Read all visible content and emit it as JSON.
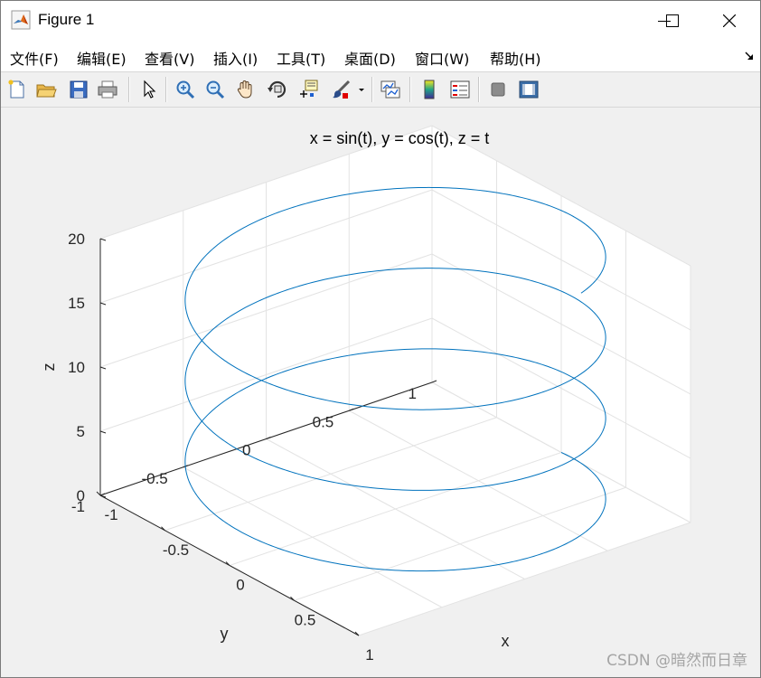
{
  "window": {
    "title": "Figure 1",
    "icon": "matlab-logo-icon",
    "controls": [
      "minimize-icon",
      "maximize-icon",
      "close-icon"
    ]
  },
  "menu": {
    "items": [
      "文件(F)",
      "编辑(E)",
      "查看(V)",
      "插入(I)",
      "工具(T)",
      "桌面(D)",
      "窗口(W)",
      "帮助(H)"
    ]
  },
  "toolbar": {
    "icons": [
      "new-figure-icon",
      "open-file-icon",
      "save-icon",
      "print-icon",
      "pointer-icon",
      "zoom-in-icon",
      "zoom-out-icon",
      "pan-hand-icon",
      "rotate-3d-icon",
      "data-cursor-icon",
      "brush-icon",
      "link-plot-icon",
      "colorbar-icon",
      "legend-icon",
      "hide-plot-tools-icon",
      "show-plot-tools-icon"
    ]
  },
  "chart_data": {
    "type": "line",
    "projection": "3d",
    "title": "x = sin(t), y = cos(t), z = t",
    "xlabel": "x",
    "ylabel": "y",
    "zlabel": "z",
    "series": [
      {
        "equation": "x = sin(t), y = cos(t), z = t",
        "t_range": [
          0,
          20
        ],
        "color": "#0072bd"
      }
    ],
    "xlim": [
      -1,
      1
    ],
    "ylim": [
      -1,
      1
    ],
    "zlim": [
      0,
      20
    ],
    "xticks": [
      "-1",
      "-0.5",
      "0",
      "0.5",
      "1"
    ],
    "yticks": [
      "-1",
      "-0.5",
      "0",
      "0.5",
      "1"
    ],
    "zticks": [
      "0",
      "5",
      "10",
      "15",
      "20"
    ],
    "grid": true,
    "view": {
      "azimuth": -37.5,
      "elevation": 30
    }
  },
  "watermark": "CSDN @暗然而日章"
}
